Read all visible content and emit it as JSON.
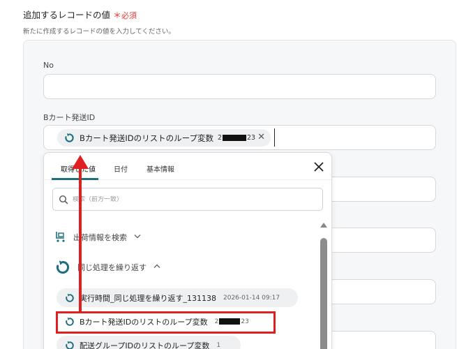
{
  "section": {
    "title": "追加するレコードの値",
    "required_star": "＊",
    "required_label": "必須",
    "description": "新たに作成するレコードの値を入力してください。"
  },
  "fields": {
    "no_label": "No",
    "bcart_label": "Bカート発送ID",
    "chip": {
      "label": "Bカート発送IDのリストのループ変数",
      "id_prefix": "2",
      "id_suffix": "23",
      "remove_glyph": "✕"
    }
  },
  "dropdown": {
    "tabs": [
      "取得した値",
      "日付",
      "基本情報"
    ],
    "active_tab": "取得した値",
    "close_glyph": "✕",
    "search_placeholder": "検索（前方一致）",
    "groups": [
      {
        "label": "出荷情報を検索",
        "chevron": "⌄",
        "icon": "cart-icon"
      },
      {
        "label": "同じ処理を繰り返す",
        "chevron": "⌃",
        "icon": "loop-icon"
      }
    ],
    "items": [
      {
        "name": "実行時間_同じ処理を繰り返す_131138",
        "meta": "2026-01-14 09:17"
      },
      {
        "name": "Bカート発送IDのリストのループ変数",
        "meta_prefix": "2",
        "meta_suffix": "23"
      },
      {
        "name": "配送グループIDのリストのループ変数",
        "meta": "1"
      }
    ]
  },
  "colors": {
    "accent": "#1f6e7e",
    "annotation_red": "#e02020",
    "required_red": "#e53935"
  }
}
